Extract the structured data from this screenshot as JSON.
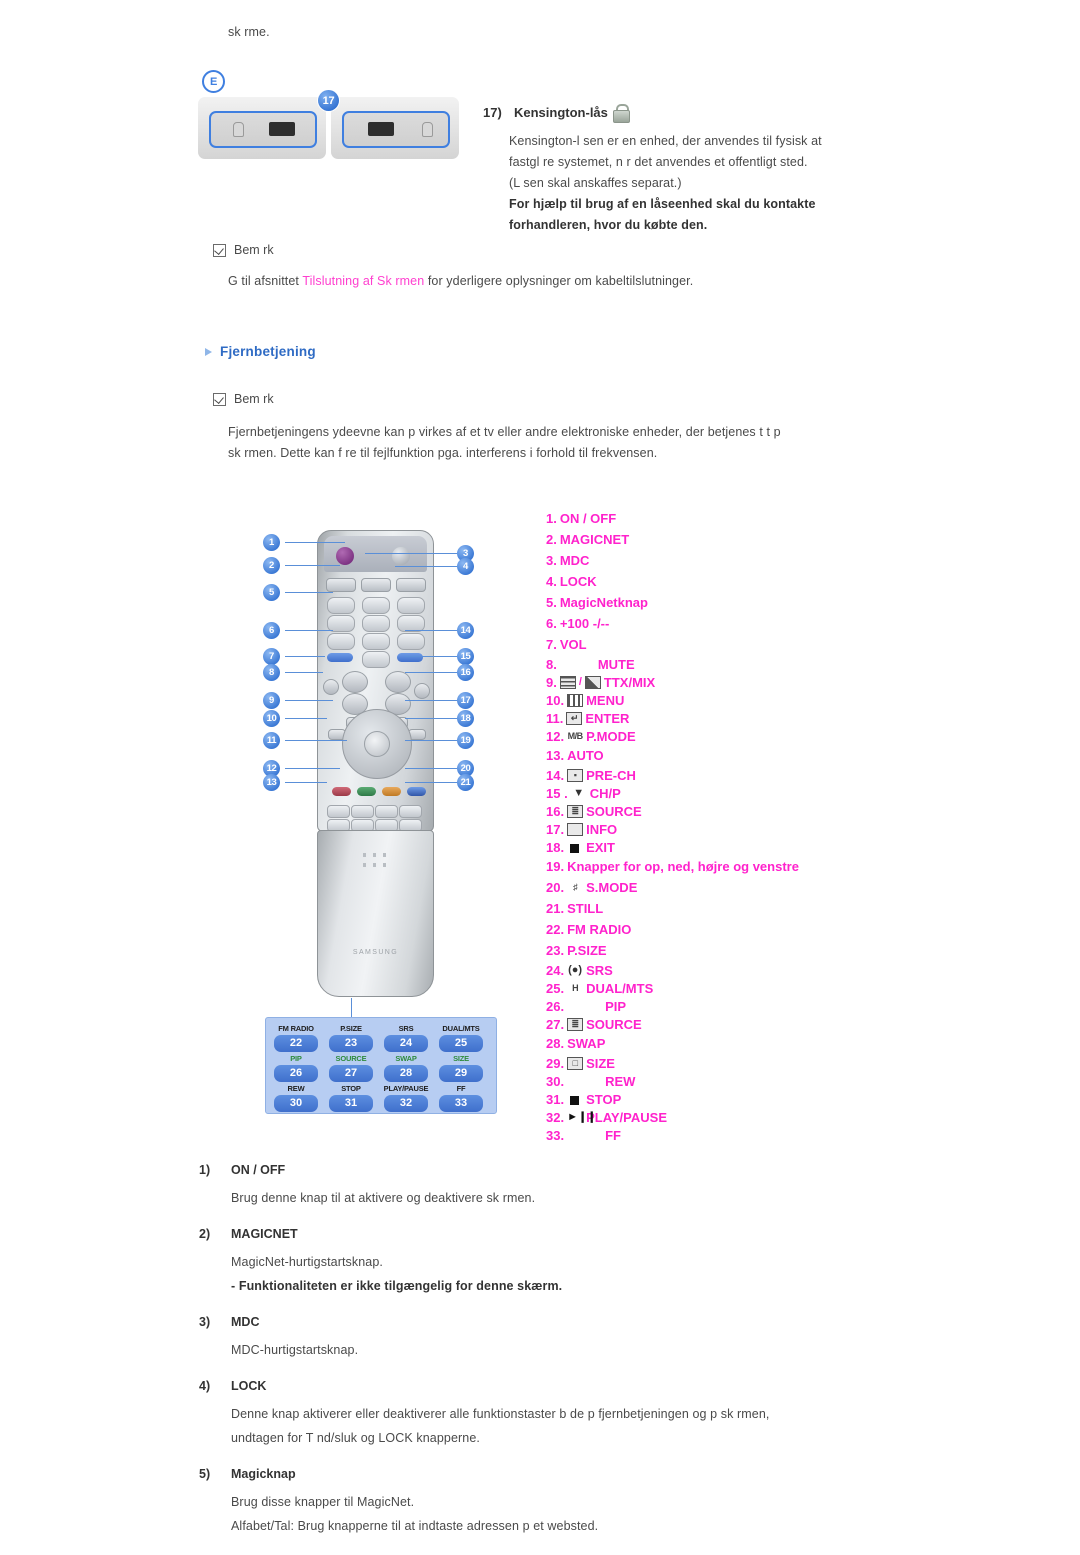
{
  "top_fragment": "sk rme.",
  "port_figure": {
    "badge_e": "E",
    "badge_number": "17"
  },
  "kensington": {
    "number": "17)",
    "title": "Kensington-lås",
    "lines": [
      "Kensington-l sen er en enhed, der anvendes til fysisk at",
      "fastgl re systemet, n r det anvendes et offentligt sted.",
      "(L sen skal anskaffes separat.)"
    ],
    "bold_lines": [
      "For hjælp til brug af en låseenhed skal du kontakte",
      "forhandleren, hvor du købte den."
    ]
  },
  "note1": {
    "label": "Bem rk",
    "text_before": "G  til afsnittet",
    "link": "Tilslutning af Sk rmen",
    "text_after": "for yderligere oplysninger om kabeltilslutninger."
  },
  "section_heading": "Fjernbetjening",
  "note2": {
    "label": "Bem rk",
    "lines": [
      "Fjernbetjeningens ydeevne kan p virkes af et tv eller andre elektroniske enheder, der betjenes t t p",
      "sk rmen. Dette kan f re til fejlfunktion pga. interferens i forhold til frekvensen."
    ]
  },
  "remote": {
    "brand": "SAMSUNG",
    "callouts": [
      "1",
      "2",
      "3",
      "4",
      "5",
      "6",
      "7",
      "8",
      "9",
      "10",
      "11",
      "12",
      "13",
      "14",
      "15",
      "16",
      "17",
      "18",
      "19",
      "20",
      "21"
    ],
    "key_panel": [
      {
        "label": "FM RADIO",
        "number": "22",
        "green": false
      },
      {
        "label": "P.SIZE",
        "number": "23",
        "green": false
      },
      {
        "label": "SRS",
        "number": "24",
        "green": false
      },
      {
        "label": "DUAL/MTS",
        "number": "25",
        "green": false
      },
      {
        "label": "PIP",
        "number": "26",
        "green": true
      },
      {
        "label": "SOURCE",
        "number": "27",
        "green": true
      },
      {
        "label": "SWAP",
        "number": "28",
        "green": true
      },
      {
        "label": "SIZE",
        "number": "29",
        "green": true
      },
      {
        "label": "REW",
        "number": "30",
        "green": false
      },
      {
        "label": "STOP",
        "number": "31",
        "green": false
      },
      {
        "label": "PLAY/PAUSE",
        "number": "32",
        "green": false
      },
      {
        "label": "FF",
        "number": "33",
        "green": false
      }
    ]
  },
  "legend": [
    {
      "n": "1.",
      "label": "ON / OFF",
      "icon": "none",
      "spacing": "wide"
    },
    {
      "n": "2.",
      "label": "MAGICNET",
      "icon": "none",
      "spacing": "wide"
    },
    {
      "n": "3.",
      "label": "MDC",
      "icon": "none",
      "spacing": "wide"
    },
    {
      "n": "4.",
      "label": "LOCK",
      "icon": "none",
      "spacing": "wide"
    },
    {
      "n": "5.",
      "label": "MagicNetknap",
      "icon": "none",
      "spacing": "wide"
    },
    {
      "n": "6.",
      "label": "+100 -/--",
      "icon": "none",
      "spacing": "wide"
    },
    {
      "n": "7.",
      "label": "VOL",
      "icon": "none",
      "spacing": "wide"
    },
    {
      "n": "8.",
      "label": "MUTE",
      "icon": "blank",
      "spacing": "tight"
    },
    {
      "n": "9.",
      "label": "TTX/MIX",
      "icon": "ttxmix",
      "spacing": "tight"
    },
    {
      "n": "10.",
      "label": "MENU",
      "icon": "menu",
      "spacing": "tight"
    },
    {
      "n": "11.",
      "label": "ENTER",
      "icon": "enter",
      "spacing": "tight"
    },
    {
      "n": "12.",
      "label": "P.MODE",
      "icon": "mb",
      "spacing": "tight"
    },
    {
      "n": "13.",
      "label": "AUTO",
      "icon": "none",
      "spacing": "wide"
    },
    {
      "n": "14.",
      "label": "PRE-CH",
      "icon": "prech",
      "spacing": "tight"
    },
    {
      "n": "15 .",
      "label": "CH/P",
      "icon": "chp",
      "spacing": "tight"
    },
    {
      "n": "16.",
      "label": "SOURCE",
      "icon": "source",
      "spacing": "tight"
    },
    {
      "n": "17.",
      "label": "INFO",
      "icon": "info",
      "spacing": "tight"
    },
    {
      "n": "18.",
      "label": "EXIT",
      "icon": "exit",
      "spacing": "tight"
    },
    {
      "n": "19.",
      "label": "Knapper for op, ned, højre og venstre",
      "icon": "none",
      "spacing": "wide"
    },
    {
      "n": "20.",
      "label": "S.MODE",
      "icon": "smode",
      "spacing": "wide"
    },
    {
      "n": "21.",
      "label": "STILL",
      "icon": "none",
      "spacing": "wide"
    },
    {
      "n": "22.",
      "label": "FM RADIO",
      "icon": "none",
      "spacing": "wide"
    },
    {
      "n": "23.",
      "label": "P.SIZE",
      "icon": "none",
      "spacing": "wide"
    },
    {
      "n": "24.",
      "label": "SRS",
      "icon": "srs",
      "spacing": "tight"
    },
    {
      "n": "25.",
      "label": "DUAL/MTS",
      "icon": "dual",
      "spacing": "tight"
    },
    {
      "n": "26.",
      "label": "PIP",
      "icon": "blank",
      "spacing": "tight"
    },
    {
      "n": "27.",
      "label": "SOURCE",
      "icon": "source",
      "spacing": "tight"
    },
    {
      "n": "28.",
      "label": "SWAP",
      "icon": "none",
      "spacing": "wide"
    },
    {
      "n": "29.",
      "label": "SIZE",
      "icon": "size",
      "spacing": "tight"
    },
    {
      "n": "30.",
      "label": "REW",
      "icon": "blank",
      "spacing": "tight"
    },
    {
      "n": "31.",
      "label": "STOP",
      "icon": "stop",
      "spacing": "tight"
    },
    {
      "n": "32.",
      "label": "PLAY/PAUSE",
      "icon": "play",
      "spacing": "tight"
    },
    {
      "n": "33.",
      "label": "FF",
      "icon": "blank",
      "spacing": "tight"
    }
  ],
  "descriptions": [
    {
      "num": "1)",
      "title": "ON / OFF",
      "lines": [
        "Brug denne knap til at aktivere og deaktivere sk rmen."
      ],
      "bold_lines": []
    },
    {
      "num": "2)",
      "title": "MAGICNET",
      "lines": [
        "MagicNet-hurtigstartsknap."
      ],
      "bold_lines": [
        "- Funktionaliteten er ikke tilgængelig for denne skærm."
      ]
    },
    {
      "num": "3)",
      "title": "MDC",
      "lines": [
        "MDC-hurtigstartsknap."
      ],
      "bold_lines": []
    },
    {
      "num": "4)",
      "title": "LOCK",
      "lines": [
        "Denne knap aktiverer eller deaktiverer alle funktionstaster b de p  fjernbetjeningen og p  sk rmen,",
        "undtagen for T nd/sluk og LOCK knapperne."
      ],
      "bold_lines": []
    },
    {
      "num": "5)",
      "title": "Magicknap",
      "lines": [
        "Brug disse knapper til MagicNet.",
        "Alfabet/Tal: Brug knapperne til at indtaste adressen p  et websted."
      ],
      "bold_lines": []
    }
  ],
  "colors": {
    "legend_magenta": "#ff22cc",
    "heading_blue": "#2f6bc4",
    "link_pink": "#ff3fcf",
    "callout_blue": "#2f6fd0"
  }
}
